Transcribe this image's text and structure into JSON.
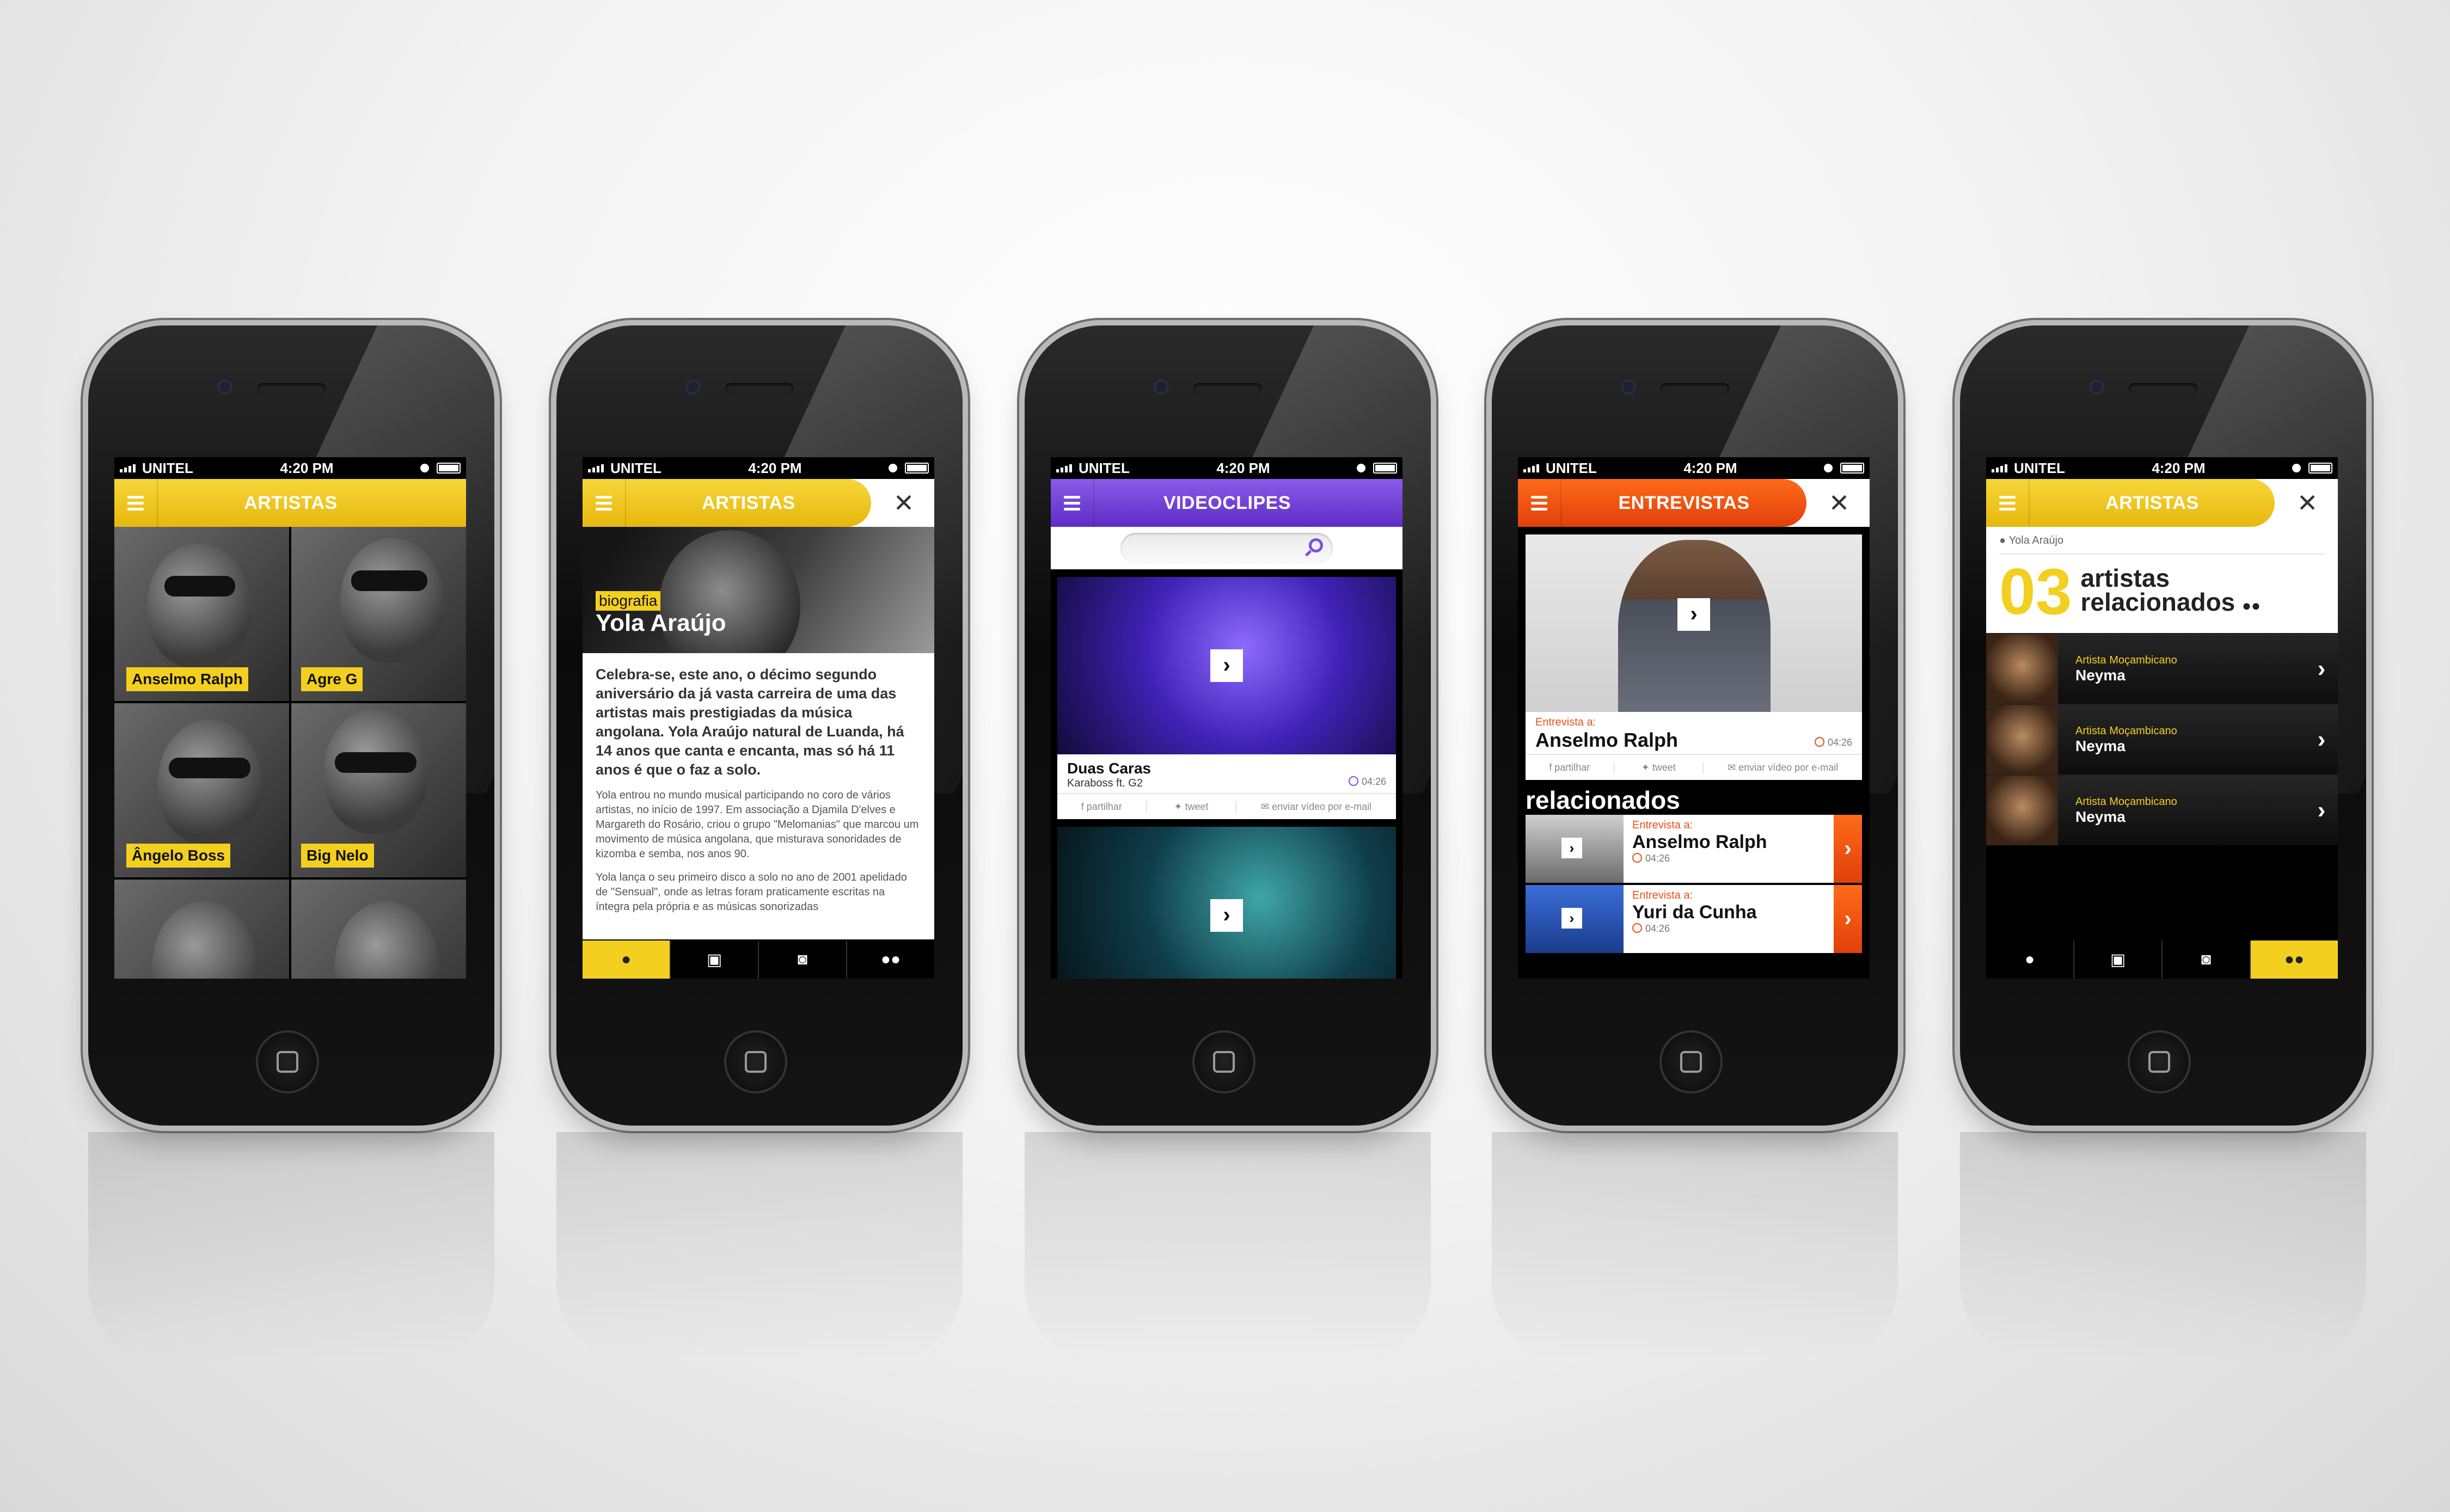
{
  "status": {
    "carrier": "UNITEL",
    "time": "4:20 PM"
  },
  "screen1": {
    "title": "ARTISTAS",
    "artists": [
      {
        "name": "Anselmo Ralph"
      },
      {
        "name": "Agre G"
      },
      {
        "name": "Ângelo Boss"
      },
      {
        "name": "Big Nelo"
      },
      {
        "name": ""
      },
      {
        "name": ""
      }
    ]
  },
  "screen2": {
    "title": "ARTISTAS",
    "tag": "biografia",
    "name": "Yola Araújo",
    "lead": "Celebra-se, este ano, o décimo segundo aniversário da já vasta carreira de uma das artistas mais prestigiadas da música angolana. Yola Araújo natural de Luanda, há 14 anos que canta e encanta, mas só há 11 anos é que o faz a solo.",
    "p1": "Yola entrou no mundo musical participando no coro de vários artistas, no início de 1997. Em associação a Djamila D'elves e Margareth do Rosário, criou o grupo \"Melomanias\" que marcou um movimento de música angolana, que misturava sonoridades de kizomba e semba, nos anos 90.",
    "p2": "Yola lança o seu primeiro disco a solo no ano de 2001 apelidado de \"Sensual\", onde as letras foram praticamente escritas na íntegra pela própria e as músicas sonorizadas"
  },
  "screen3": {
    "title": "VIDEOCLIPES",
    "search_placeholder": "",
    "videos": [
      {
        "title": "Duas Caras",
        "artist": "Karaboss ft. G2",
        "duration": "04:26"
      }
    ],
    "share": {
      "share": "partilhar",
      "tweet": "tweet",
      "email": "enviar vídeo por e-mail"
    }
  },
  "screen4": {
    "title": "ENTREVISTAS",
    "main": {
      "label": "Entrevista a:",
      "name": "Anselmo Ralph",
      "duration": "04:26"
    },
    "share": {
      "share": "partilhar",
      "tweet": "tweet",
      "email": "enviar vídeo por e-mail"
    },
    "related_heading": "relacionados",
    "related": [
      {
        "label": "Entrevista a:",
        "name": "Anselmo Ralph",
        "duration": "04:26"
      },
      {
        "label": "Entrevista a:",
        "name": "Yuri da Cunha",
        "duration": "04:26"
      }
    ]
  },
  "screen5": {
    "title": "ARTISTAS",
    "crumb": "Yola Araújo",
    "count": "03",
    "count_label_1": "artistas",
    "count_label_2": "relacionados",
    "items": [
      {
        "type": "Artista Moçambicano",
        "name": "Neyma"
      },
      {
        "type": "Artista Moçambicano",
        "name": "Neyma"
      },
      {
        "type": "Artista Moçambicano",
        "name": "Neyma"
      }
    ]
  },
  "colors": {
    "yellow": "#f3cf1f",
    "purple": "#6a3ad6",
    "orange": "#f05014"
  }
}
